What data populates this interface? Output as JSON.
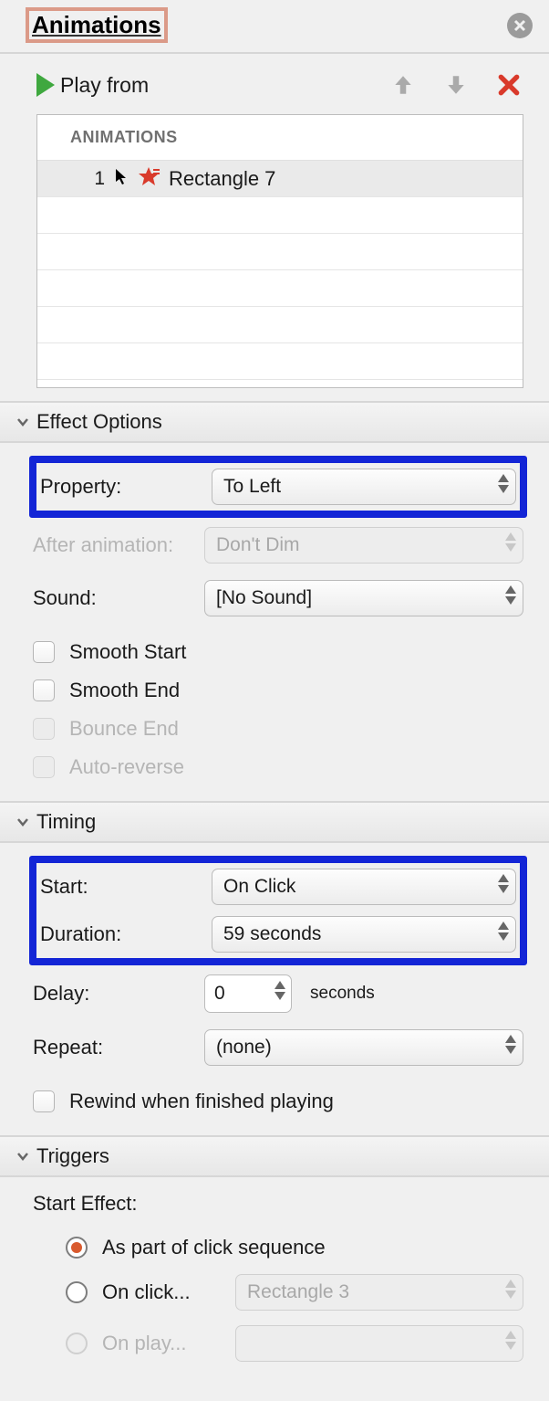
{
  "header": {
    "title": "Animations"
  },
  "toolbar": {
    "play_label": "Play from"
  },
  "list": {
    "header": "ANIMATIONS",
    "items": [
      {
        "index": "1",
        "label": "Rectangle 7"
      }
    ]
  },
  "sections": {
    "effect": {
      "title": "Effect Options",
      "labels": {
        "property": "Property:",
        "after_animation": "After animation:",
        "sound": "Sound:",
        "smooth_start": "Smooth Start",
        "smooth_end": "Smooth End",
        "bounce_end": "Bounce End",
        "auto_reverse": "Auto-reverse"
      },
      "values": {
        "property": "To Left",
        "after_animation": "Don't Dim",
        "sound": "[No Sound]"
      }
    },
    "timing": {
      "title": "Timing",
      "labels": {
        "start": "Start:",
        "duration": "Duration:",
        "delay": "Delay:",
        "repeat": "Repeat:",
        "rewind": "Rewind when finished playing",
        "seconds": "seconds"
      },
      "values": {
        "start": "On Click",
        "duration": "59 seconds",
        "delay": "0",
        "repeat": "(none)"
      }
    },
    "triggers": {
      "title": "Triggers",
      "labels": {
        "start_effect": "Start Effect:",
        "as_part": "As part of click sequence",
        "on_click": "On click...",
        "on_play": "On play..."
      },
      "values": {
        "on_click_target": "Rectangle 3",
        "on_play_target": ""
      }
    }
  }
}
